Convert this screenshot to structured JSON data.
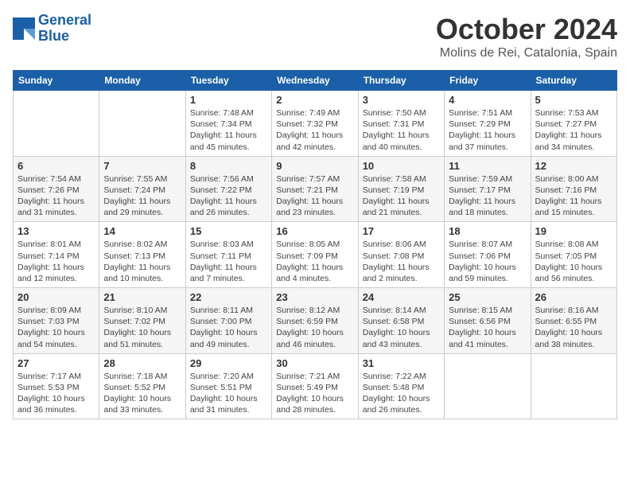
{
  "header": {
    "logo_line1": "General",
    "logo_line2": "Blue",
    "month": "October 2024",
    "location": "Molins de Rei, Catalonia, Spain"
  },
  "weekdays": [
    "Sunday",
    "Monday",
    "Tuesday",
    "Wednesday",
    "Thursday",
    "Friday",
    "Saturday"
  ],
  "weeks": [
    [
      {
        "day": "",
        "info": ""
      },
      {
        "day": "",
        "info": ""
      },
      {
        "day": "1",
        "info": "Sunrise: 7:48 AM\nSunset: 7:34 PM\nDaylight: 11 hours and 45 minutes."
      },
      {
        "day": "2",
        "info": "Sunrise: 7:49 AM\nSunset: 7:32 PM\nDaylight: 11 hours and 42 minutes."
      },
      {
        "day": "3",
        "info": "Sunrise: 7:50 AM\nSunset: 7:31 PM\nDaylight: 11 hours and 40 minutes."
      },
      {
        "day": "4",
        "info": "Sunrise: 7:51 AM\nSunset: 7:29 PM\nDaylight: 11 hours and 37 minutes."
      },
      {
        "day": "5",
        "info": "Sunrise: 7:53 AM\nSunset: 7:27 PM\nDaylight: 11 hours and 34 minutes."
      }
    ],
    [
      {
        "day": "6",
        "info": "Sunrise: 7:54 AM\nSunset: 7:26 PM\nDaylight: 11 hours and 31 minutes."
      },
      {
        "day": "7",
        "info": "Sunrise: 7:55 AM\nSunset: 7:24 PM\nDaylight: 11 hours and 29 minutes."
      },
      {
        "day": "8",
        "info": "Sunrise: 7:56 AM\nSunset: 7:22 PM\nDaylight: 11 hours and 26 minutes."
      },
      {
        "day": "9",
        "info": "Sunrise: 7:57 AM\nSunset: 7:21 PM\nDaylight: 11 hours and 23 minutes."
      },
      {
        "day": "10",
        "info": "Sunrise: 7:58 AM\nSunset: 7:19 PM\nDaylight: 11 hours and 21 minutes."
      },
      {
        "day": "11",
        "info": "Sunrise: 7:59 AM\nSunset: 7:17 PM\nDaylight: 11 hours and 18 minutes."
      },
      {
        "day": "12",
        "info": "Sunrise: 8:00 AM\nSunset: 7:16 PM\nDaylight: 11 hours and 15 minutes."
      }
    ],
    [
      {
        "day": "13",
        "info": "Sunrise: 8:01 AM\nSunset: 7:14 PM\nDaylight: 11 hours and 12 minutes."
      },
      {
        "day": "14",
        "info": "Sunrise: 8:02 AM\nSunset: 7:13 PM\nDaylight: 11 hours and 10 minutes."
      },
      {
        "day": "15",
        "info": "Sunrise: 8:03 AM\nSunset: 7:11 PM\nDaylight: 11 hours and 7 minutes."
      },
      {
        "day": "16",
        "info": "Sunrise: 8:05 AM\nSunset: 7:09 PM\nDaylight: 11 hours and 4 minutes."
      },
      {
        "day": "17",
        "info": "Sunrise: 8:06 AM\nSunset: 7:08 PM\nDaylight: 11 hours and 2 minutes."
      },
      {
        "day": "18",
        "info": "Sunrise: 8:07 AM\nSunset: 7:06 PM\nDaylight: 10 hours and 59 minutes."
      },
      {
        "day": "19",
        "info": "Sunrise: 8:08 AM\nSunset: 7:05 PM\nDaylight: 10 hours and 56 minutes."
      }
    ],
    [
      {
        "day": "20",
        "info": "Sunrise: 8:09 AM\nSunset: 7:03 PM\nDaylight: 10 hours and 54 minutes."
      },
      {
        "day": "21",
        "info": "Sunrise: 8:10 AM\nSunset: 7:02 PM\nDaylight: 10 hours and 51 minutes."
      },
      {
        "day": "22",
        "info": "Sunrise: 8:11 AM\nSunset: 7:00 PM\nDaylight: 10 hours and 49 minutes."
      },
      {
        "day": "23",
        "info": "Sunrise: 8:12 AM\nSunset: 6:59 PM\nDaylight: 10 hours and 46 minutes."
      },
      {
        "day": "24",
        "info": "Sunrise: 8:14 AM\nSunset: 6:58 PM\nDaylight: 10 hours and 43 minutes."
      },
      {
        "day": "25",
        "info": "Sunrise: 8:15 AM\nSunset: 6:56 PM\nDaylight: 10 hours and 41 minutes."
      },
      {
        "day": "26",
        "info": "Sunrise: 8:16 AM\nSunset: 6:55 PM\nDaylight: 10 hours and 38 minutes."
      }
    ],
    [
      {
        "day": "27",
        "info": "Sunrise: 7:17 AM\nSunset: 5:53 PM\nDaylight: 10 hours and 36 minutes."
      },
      {
        "day": "28",
        "info": "Sunrise: 7:18 AM\nSunset: 5:52 PM\nDaylight: 10 hours and 33 minutes."
      },
      {
        "day": "29",
        "info": "Sunrise: 7:20 AM\nSunset: 5:51 PM\nDaylight: 10 hours and 31 minutes."
      },
      {
        "day": "30",
        "info": "Sunrise: 7:21 AM\nSunset: 5:49 PM\nDaylight: 10 hours and 28 minutes."
      },
      {
        "day": "31",
        "info": "Sunrise: 7:22 AM\nSunset: 5:48 PM\nDaylight: 10 hours and 26 minutes."
      },
      {
        "day": "",
        "info": ""
      },
      {
        "day": "",
        "info": ""
      }
    ]
  ]
}
